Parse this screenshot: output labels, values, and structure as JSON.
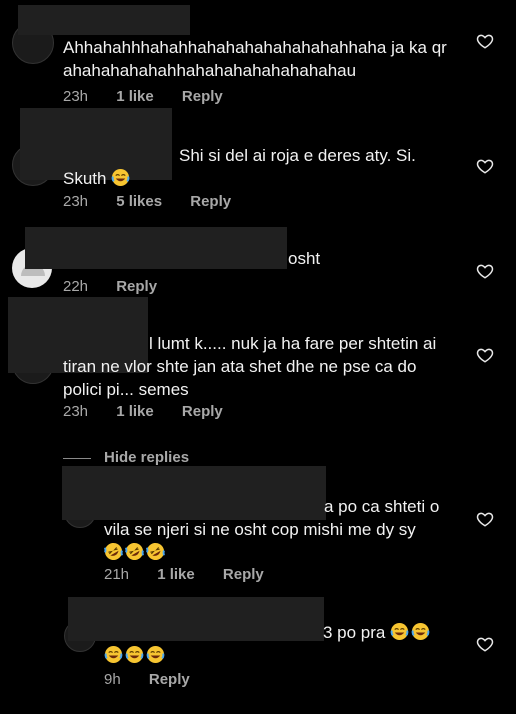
{
  "comments": [
    {
      "text": "Ahhahahhhahahhahahahahahahahahhaha ja ka qr ahahahahahahhahahahahahahahahau",
      "time": "23h",
      "likes": "1 like",
      "reply": "Reply"
    },
    {
      "text": "Shi si del ai roja e deres aty. Si. Skuth",
      "time": "23h",
      "likes": "5 likes",
      "reply": "Reply"
    },
    {
      "text": "osht",
      "time": "22h",
      "reply": "Reply"
    },
    {
      "text": "l lumt k..... nuk ja ha fare per shtetin ai tiran ne vlor shte jan ata shet dhe ne pse ca do polici pi... semes",
      "time": "23h",
      "likes": "1 like",
      "reply": "Reply"
    }
  ],
  "hide_replies": "Hide replies",
  "replies": [
    {
      "text": "a po ca shteti o vila se njeri si ne osht cop mishi me dy sy",
      "time": "21h",
      "likes": "1 like",
      "reply": "Reply"
    },
    {
      "text": "3 po pra",
      "time": "9h",
      "reply": "Reply"
    }
  ],
  "icons": {
    "like": "heart-outline-icon",
    "emoji": "rolling-laughing-emoji",
    "emoji2": "tears-of-joy-emoji"
  }
}
